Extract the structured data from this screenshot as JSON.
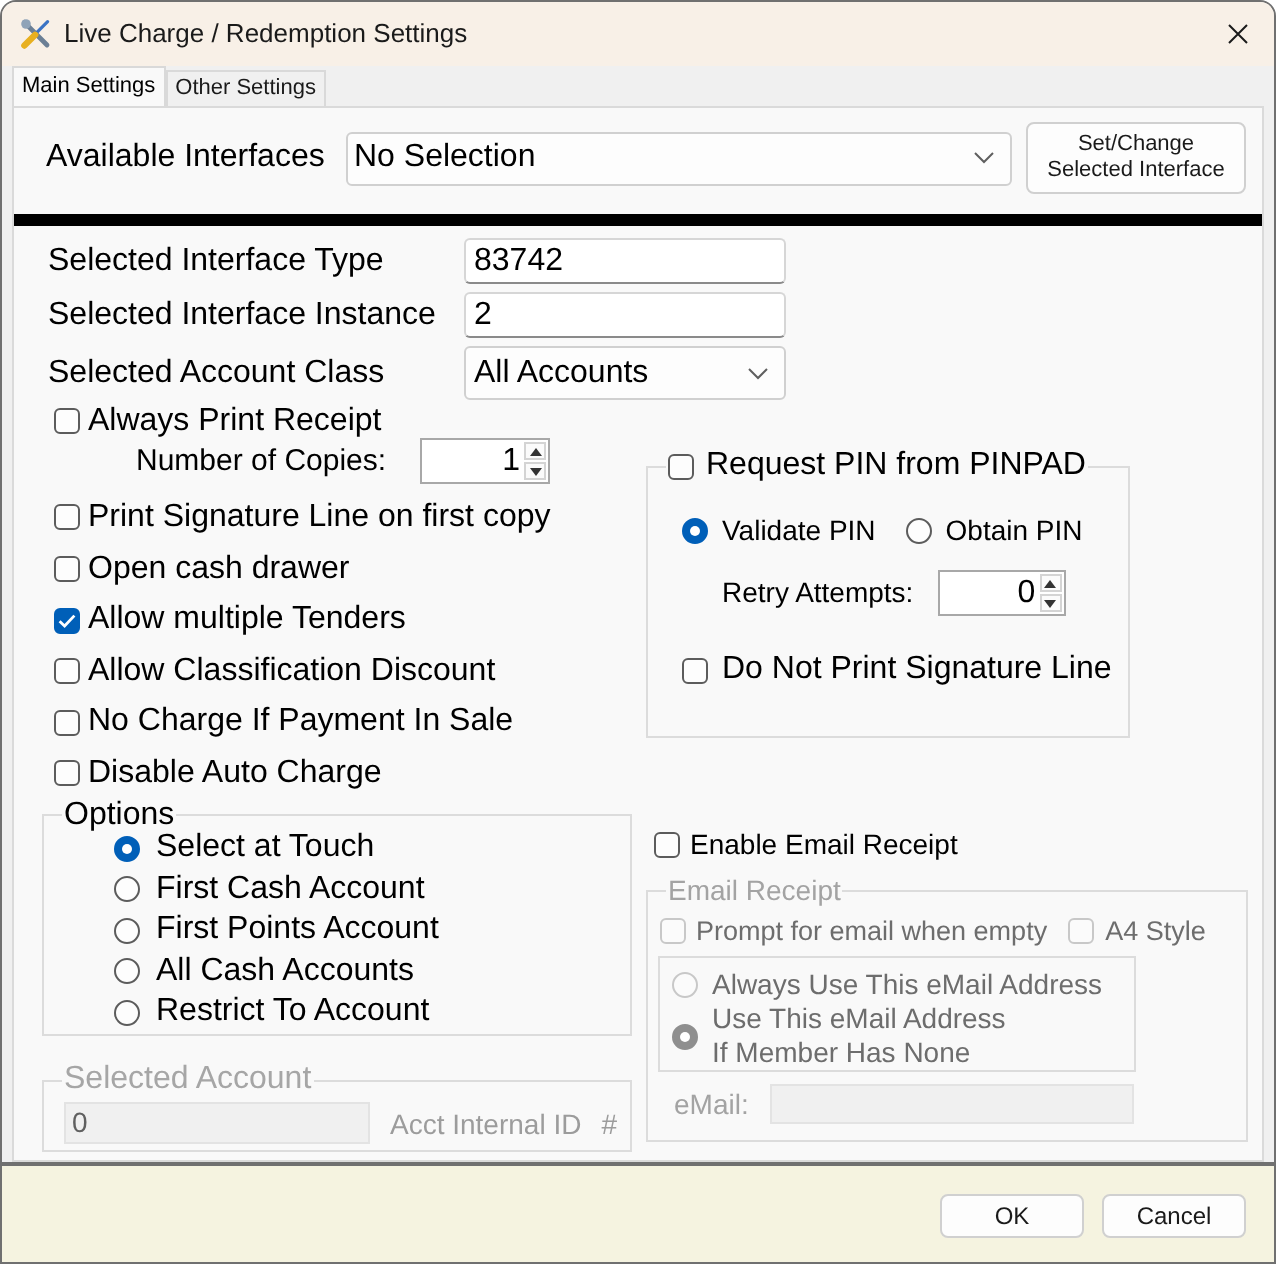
{
  "window": {
    "title": "Live Charge / Redemption Settings"
  },
  "tabs": [
    {
      "label": "Main Settings",
      "selected": true
    },
    {
      "label": "Other Settings",
      "selected": false
    }
  ],
  "interfaces": {
    "label": "Available Interfaces",
    "value": "No Selection",
    "button_lines": [
      "Set/Change",
      "Selected Interface"
    ]
  },
  "fields": [
    {
      "kind": "text",
      "label": "Selected Interface Type",
      "value": "83742"
    },
    {
      "kind": "text",
      "label": "Selected Interface Instance",
      "value": "2"
    },
    {
      "kind": "dropdown",
      "label": "Selected Account Class",
      "value": "All Accounts"
    }
  ],
  "print_receipt": {
    "label": "Always Print Receipt",
    "checked": false,
    "copies_label": "Number of Copies:",
    "copies": "1"
  },
  "checkboxes": [
    {
      "label": "Print Signature Line on first copy",
      "checked": false
    },
    {
      "label": "Open cash drawer",
      "checked": false
    },
    {
      "label": "Allow multiple Tenders",
      "checked": true
    },
    {
      "label": "Allow Classification Discount",
      "checked": false
    },
    {
      "label": "No Charge If Payment In Sale",
      "checked": false
    },
    {
      "label": "Disable Auto Charge",
      "checked": false
    }
  ],
  "options": {
    "title": "Options",
    "items": [
      {
        "label": "Select at Touch",
        "selected": true
      },
      {
        "label": "First Cash Account",
        "selected": false
      },
      {
        "label": "First Points Account",
        "selected": false
      },
      {
        "label": "All Cash Accounts",
        "selected": false
      },
      {
        "label": "Restrict To Account",
        "selected": false
      }
    ]
  },
  "selected_account": {
    "title": "Selected Account",
    "disabled": true,
    "value": "0",
    "caption": "Acct Internal ID",
    "suffix": "#"
  },
  "pin": {
    "label": "Request PIN from PINPAD",
    "checked": false,
    "modes": [
      {
        "label": "Validate PIN",
        "selected": true
      },
      {
        "label": "Obtain PIN",
        "selected": false
      }
    ],
    "retry_label": "Retry Attempts:",
    "retry": "0",
    "no_signature": {
      "label": "Do Not Print Signature Line",
      "checked": false
    }
  },
  "email": {
    "enable": {
      "label": "Enable Email Receipt",
      "checked": false
    },
    "title": "Email Receipt",
    "disabled": true,
    "prompt": {
      "label": "Prompt for email when empty",
      "checked": false
    },
    "a4": {
      "label": "A4 Style",
      "checked": false
    },
    "address_modes": [
      {
        "lines": [
          "Always Use This eMail Address"
        ],
        "selected": false
      },
      {
        "lines": [
          "Use This eMail Address",
          "If Member Has None"
        ],
        "selected": true
      }
    ],
    "email_label": "eMail:"
  },
  "buttons": [
    {
      "label": "OK"
    },
    {
      "label": "Cancel"
    }
  ]
}
